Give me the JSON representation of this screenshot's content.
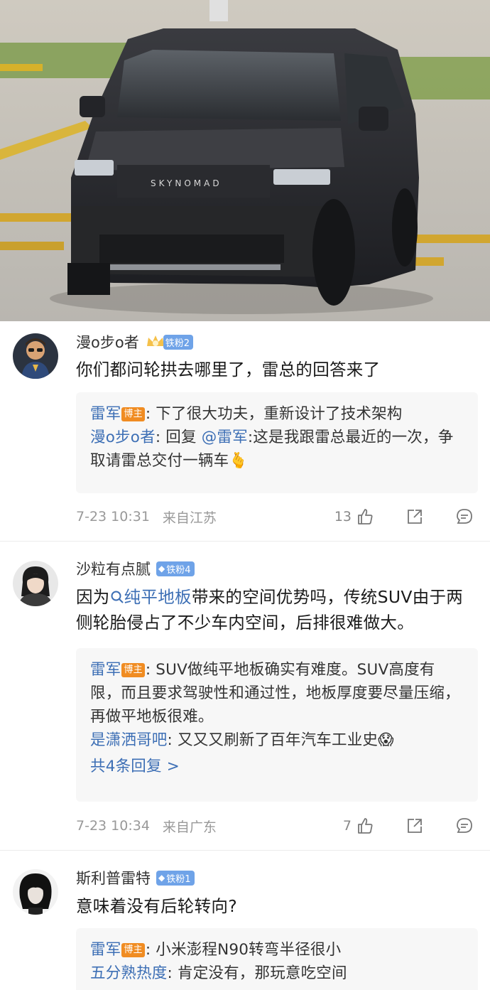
{
  "photo": {
    "car_badge": "SKYNOMAD"
  },
  "comments": [
    {
      "user": "漫o步o者",
      "fan_level": "铁粉2",
      "text": "你们都问轮拱去哪里了，雷总的回答来了",
      "replies": [
        {
          "who": "雷军",
          "badge": "博主",
          "text": ": 下了很大功夫，重新设计了技术架构"
        },
        {
          "who": "漫o步o者",
          "text_pre": ": 回复 ",
          "mention": "@雷军",
          "text": ":这是我跟雷总最近的一次，争取请雷总交付一辆车",
          "emoji": "🫰"
        }
      ],
      "time": "7-23 10:31",
      "location": "来自江苏",
      "likes": "13"
    },
    {
      "user": "沙粒有点腻",
      "fan_level": "铁粉4",
      "text_pre": "因为",
      "link": "纯平地板",
      "text": "带来的空间优势吗，传统SUV由于两侧轮胎侵占了不少车内空间，后排很难做大。",
      "replies": [
        {
          "who": "雷军",
          "badge": "博主",
          "text": ": SUV做纯平地板确实有难度。SUV高度有限，而且要求驾驶性和通过性，地板厚度要尽量压缩，再做平地板很难。"
        },
        {
          "who": "是潇洒哥吧",
          "text": ": 又又又刷新了百年汽车工业史",
          "emoji": "😱"
        }
      ],
      "more_replies": "共4条回复 >",
      "time": "7-23 10:34",
      "location": "来自广东",
      "likes": "7"
    },
    {
      "user": "斯利普雷特",
      "fan_level": "铁粉1",
      "text": "意味着没有后轮转向?",
      "replies": [
        {
          "who": "雷军",
          "badge": "博主",
          "text": ": 小米澎程N90转弯半径很小"
        },
        {
          "who": "五分熟热度",
          "text": ": 肯定没有，那玩意吃空间"
        }
      ]
    }
  ],
  "colors": {
    "link": "#3d6fb5",
    "fan_badge": "#6fa3e8",
    "boss_badge": "#f08c22",
    "reply_bg": "#f7f7f7",
    "meta": "#999999"
  },
  "icons": [
    "thumb-up-icon",
    "share-icon",
    "comment-icon",
    "search-icon",
    "diamond-icon",
    "crown-icon"
  ]
}
